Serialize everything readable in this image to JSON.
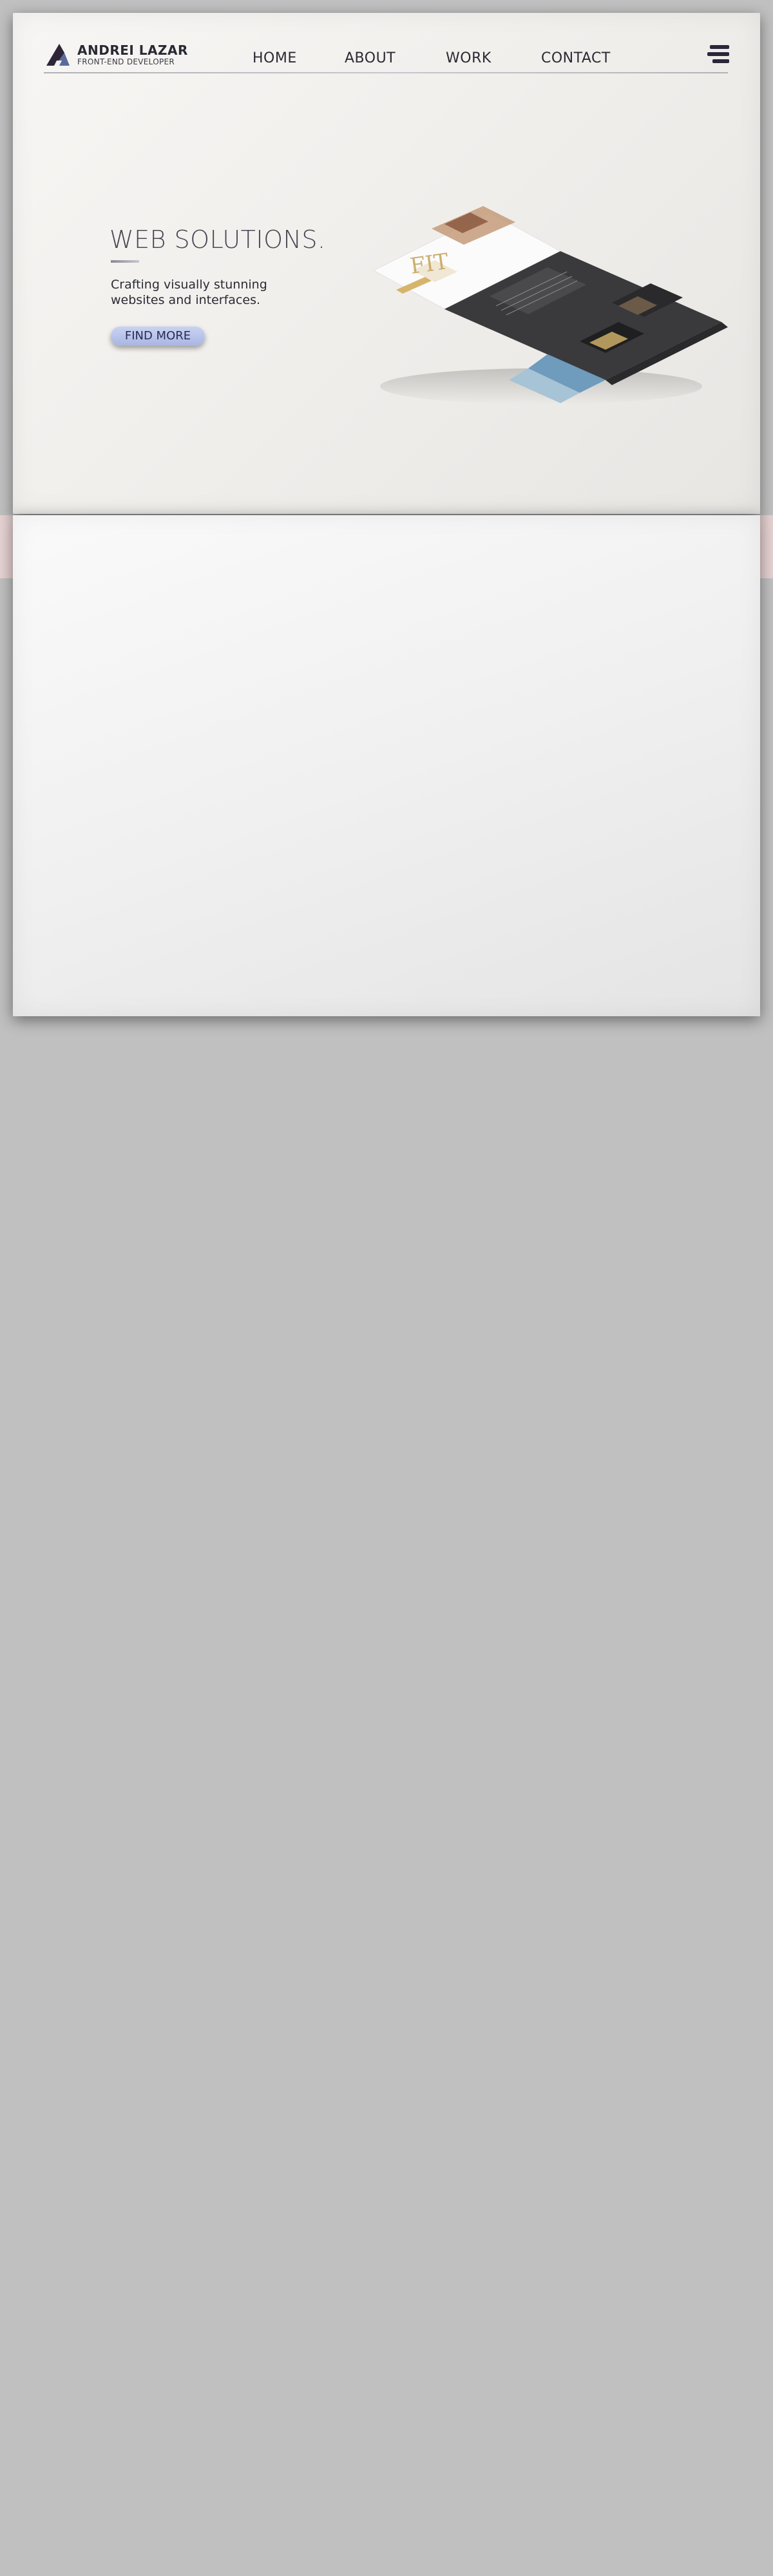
{
  "header": {
    "brand_name": "ANDREI LAZAR",
    "brand_subtitle": "FRONT-END DEVELOPER",
    "logo_icon": "triangle-logo-icon",
    "menu_icon": "hamburger-menu-icon"
  },
  "nav": {
    "items": [
      {
        "label": "HOME"
      },
      {
        "label": "ABOUT"
      },
      {
        "label": "WORK"
      },
      {
        "label": "CONTACT"
      }
    ]
  },
  "hero": {
    "headline": "WEB SOLUTIONS.",
    "tagline": "Crafting visually stunning websites and interfaces.",
    "cta_label": "FIND MORE",
    "mockup_fit_text": "FIT"
  },
  "colors": {
    "page_background": "#c0c0c0",
    "brand_dark": "#2a2a33",
    "cta_blue": "#b6c2ea",
    "band_pink": "#e6d2d2"
  }
}
